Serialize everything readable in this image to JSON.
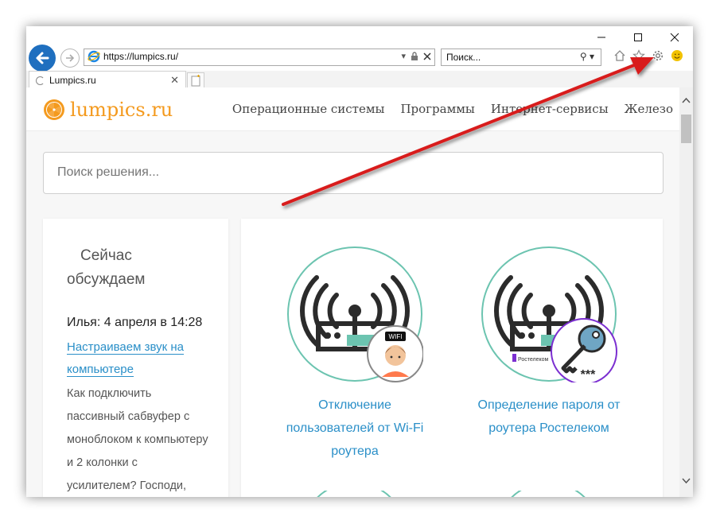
{
  "browser": {
    "url": "https://lumpics.ru/",
    "search_placeholder": "Поиск...",
    "tab_title": "Lumpics.ru"
  },
  "site": {
    "logo_text": "lumpics.ru",
    "nav": [
      "Операционные системы",
      "Программы",
      "Интернет-сервисы",
      "Железо"
    ],
    "search_placeholder": "Поиск решения..."
  },
  "sidebar": {
    "heading": "Сейчас обсуждаем",
    "author": "Илья: 4 апреля в 14:28",
    "link": "Настраиваем звук на компьютере",
    "text": "Как подключить пассивный сабвуфер с моноблоком к компьютеру и 2 колонки с усилителем? Господи,"
  },
  "articles": [
    {
      "title": "Отключение пользователей от Wi-Fi роутера",
      "badge_text": "WIFI"
    },
    {
      "title": "Определение пароля от роутера Ростелеком",
      "badge_text": "Ростелеком",
      "stars": "***"
    }
  ],
  "colors": {
    "accent_orange": "#f49a1e",
    "link_blue": "#2a8fc8",
    "arrow_red": "#d81e1e",
    "ie_blue": "#1f6fbf"
  }
}
